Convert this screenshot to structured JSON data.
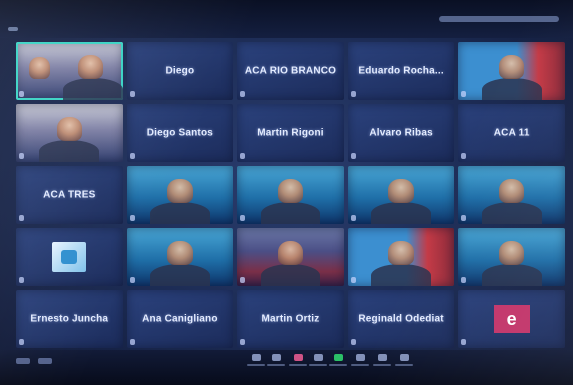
{
  "participants": [
    {
      "name": "",
      "type": "video",
      "style": "warm",
      "active": true
    },
    {
      "name": "Diego",
      "type": "name"
    },
    {
      "name": "ACA RIO BRANCO",
      "type": "name"
    },
    {
      "name": "Eduardo Rocha...",
      "type": "name"
    },
    {
      "name": "",
      "type": "video",
      "style": "redwall"
    },
    {
      "name": "",
      "type": "video",
      "style": "warm"
    },
    {
      "name": "Diego Santos",
      "type": "name"
    },
    {
      "name": "Martin Rigoni",
      "type": "name"
    },
    {
      "name": "Alvaro Ribas",
      "type": "name"
    },
    {
      "name": "ACA 11",
      "type": "name"
    },
    {
      "name": "ACA TRES",
      "type": "name"
    },
    {
      "name": "",
      "type": "video",
      "style": "cool"
    },
    {
      "name": "",
      "type": "video",
      "style": "cool"
    },
    {
      "name": "",
      "type": "video",
      "style": "cool"
    },
    {
      "name": "",
      "type": "video",
      "style": "cool"
    },
    {
      "name": "",
      "type": "logo"
    },
    {
      "name": "",
      "type": "video",
      "style": "cool"
    },
    {
      "name": "",
      "type": "video",
      "style": "red"
    },
    {
      "name": "",
      "type": "video",
      "style": "redwall"
    },
    {
      "name": "",
      "type": "video",
      "style": "cool"
    },
    {
      "name": "Ernesto Juncha",
      "type": "name"
    },
    {
      "name": "Ana Canigliano",
      "type": "name"
    },
    {
      "name": "Martin Ortiz",
      "type": "name"
    },
    {
      "name": "Reginald Odediat",
      "type": "name"
    },
    {
      "name": "",
      "type": "initial",
      "initial": "e"
    }
  ],
  "colors": {
    "active_border": "#39d3c4",
    "initial_tile": "#c2356a",
    "video_on_button": "#2fd36e"
  },
  "icons": [
    "mic-icon",
    "video-icon",
    "participants-icon",
    "chat-icon",
    "share-screen-icon",
    "record-icon",
    "reactions-icon",
    "leave-icon"
  ]
}
